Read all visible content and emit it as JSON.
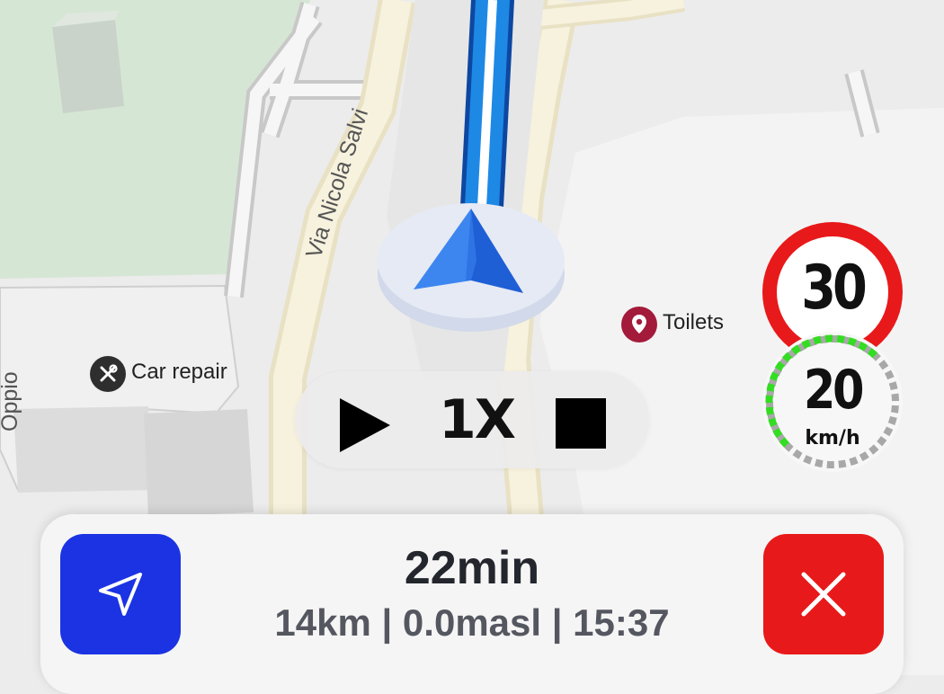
{
  "map": {
    "street_names": [
      "Via Nicola Salvi",
      "Oppio"
    ],
    "pois": [
      {
        "label": "Car repair",
        "icon": "wrench-screwdriver-icon"
      },
      {
        "label": "Toilets",
        "icon": "map-pin-icon"
      }
    ],
    "speed_limit": {
      "value": "30",
      "color": "#e8191a"
    },
    "current_speed": {
      "value": "20",
      "unit": "km/h",
      "color": "#33dd22"
    }
  },
  "simulation": {
    "play_icon": "play-icon",
    "speed_label": "1X",
    "stop_icon": "stop-icon"
  },
  "trip": {
    "eta": "22min",
    "details": "14km | 0.0masl | 15:37",
    "recenter_icon": "navigation-arrow-icon",
    "close_icon": "close-icon",
    "recenter_color": "#1b33e3",
    "close_color": "#e8191a"
  },
  "route_color": "#1a73e8"
}
